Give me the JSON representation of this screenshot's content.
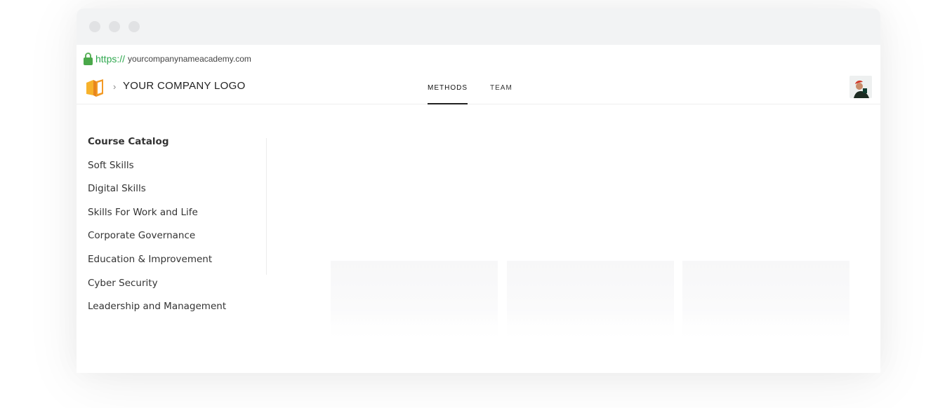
{
  "browser": {
    "protocol": "https://",
    "url": "yourcompanynameacademy.com"
  },
  "header": {
    "breadcrumb_separator": "›",
    "company": "YOUR COMPANY LOGO",
    "tabs": [
      {
        "label": "METHODS",
        "active": true
      },
      {
        "label": "TEAM",
        "active": false
      }
    ]
  },
  "sidebar": {
    "heading": "Course Catalog",
    "items": [
      {
        "label": "Soft Skills"
      },
      {
        "label": "Digital Skills"
      },
      {
        "label": "Skills For Work and Life"
      },
      {
        "label": "Corporate Governance"
      },
      {
        "label": "Education & Improvement"
      },
      {
        "label": "Cyber Security"
      },
      {
        "label": "Leadership and Management"
      }
    ]
  },
  "colors": {
    "secure_green": "#2fa84f",
    "logo_orange": "#f5a623",
    "titlebar": "#f2f3f4"
  },
  "icons": {
    "lock": "lock-icon",
    "logo": "book-logo-icon",
    "avatar": "user-avatar"
  }
}
